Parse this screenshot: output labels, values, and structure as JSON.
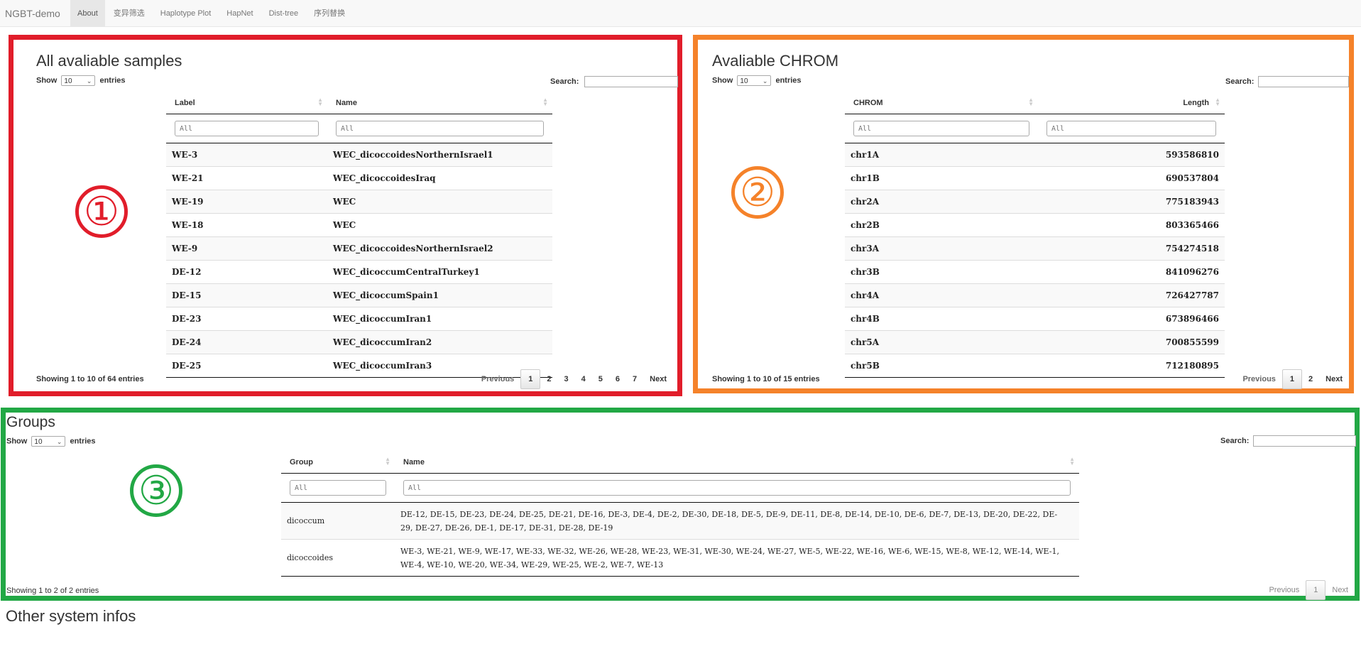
{
  "navbar": {
    "brand": "NGBT-demo",
    "items": [
      {
        "label": "About",
        "active": true
      },
      {
        "label": "变异筛选"
      },
      {
        "label": "Haplotype Plot"
      },
      {
        "label": "HapNet"
      },
      {
        "label": "Dist-tree"
      },
      {
        "label": "序列替换"
      }
    ]
  },
  "samples": {
    "marker": "①",
    "title": "All avaliable samples",
    "show_label": "Show",
    "entries_label": "entries",
    "page_length": "10",
    "search_label": "Search:",
    "columns": [
      "Label",
      "Name"
    ],
    "filter_placeholder": "All",
    "rows": [
      [
        "WE-3",
        "WEC_dicoccoidesNorthernIsrael1"
      ],
      [
        "WE-21",
        "WEC_dicoccoidesIraq"
      ],
      [
        "WE-19",
        "WEC"
      ],
      [
        "WE-18",
        "WEC"
      ],
      [
        "WE-9",
        "WEC_dicoccoidesNorthernIsrael2"
      ],
      [
        "DE-12",
        "WEC_dicoccumCentralTurkey1"
      ],
      [
        "DE-15",
        "WEC_dicoccumSpain1"
      ],
      [
        "DE-23",
        "WEC_dicoccumIran1"
      ],
      [
        "DE-24",
        "WEC_dicoccumIran2"
      ],
      [
        "DE-25",
        "WEC_dicoccumIran3"
      ]
    ],
    "info": "Showing 1 to 10 of 64 entries",
    "pagination": [
      "Previous",
      "1",
      "2",
      "3",
      "4",
      "5",
      "6",
      "7",
      "Next"
    ],
    "current_page": "1"
  },
  "chrom": {
    "marker": "②",
    "title": "Avaliable CHROM",
    "show_label": "Show",
    "entries_label": "entries",
    "page_length": "10",
    "search_label": "Search:",
    "columns": [
      "CHROM",
      "Length"
    ],
    "filter_placeholder": "All",
    "rows": [
      [
        "chr1A",
        "593586810"
      ],
      [
        "chr1B",
        "690537804"
      ],
      [
        "chr2A",
        "775183943"
      ],
      [
        "chr2B",
        "803365466"
      ],
      [
        "chr3A",
        "754274518"
      ],
      [
        "chr3B",
        "841096276"
      ],
      [
        "chr4A",
        "726427787"
      ],
      [
        "chr4B",
        "673896466"
      ],
      [
        "chr5A",
        "700855599"
      ],
      [
        "chr5B",
        "712180895"
      ]
    ],
    "info": "Showing 1 to 10 of 15 entries",
    "pagination": [
      "Previous",
      "1",
      "2",
      "Next"
    ],
    "current_page": "1"
  },
  "groups": {
    "marker": "③",
    "title": "Groups",
    "show_label": "Show",
    "entries_label": "entries",
    "page_length": "10",
    "search_label": "Search:",
    "columns": [
      "Group",
      "Name"
    ],
    "filter_placeholder": "All",
    "rows": [
      [
        "dicoccum",
        "DE-12, DE-15, DE-23, DE-24, DE-25, DE-21, DE-16, DE-3, DE-4, DE-2, DE-30, DE-18, DE-5, DE-9, DE-11, DE-8, DE-14, DE-10, DE-6, DE-7, DE-13, DE-20, DE-22, DE-29, DE-27, DE-26, DE-1, DE-17, DE-31, DE-28, DE-19"
      ],
      [
        "dicoccoides",
        "WE-3, WE-21, WE-9, WE-17, WE-33, WE-32, WE-26, WE-28, WE-23, WE-31, WE-30, WE-24, WE-27, WE-5, WE-22, WE-16, WE-6, WE-15, WE-8, WE-12, WE-14, WE-1, WE-4, WE-10, WE-20, WE-34, WE-29, WE-25, WE-2, WE-7, WE-13"
      ]
    ],
    "info": "Showing 1 to 2 of 2 entries",
    "pagination": [
      "Previous",
      "1",
      "Next"
    ],
    "current_page": "1"
  },
  "other": {
    "title": "Other system infos"
  },
  "colors": {
    "panel1_border": "#e11d2a",
    "panel2_border": "#f5822a",
    "panel3_border": "#22a845"
  }
}
